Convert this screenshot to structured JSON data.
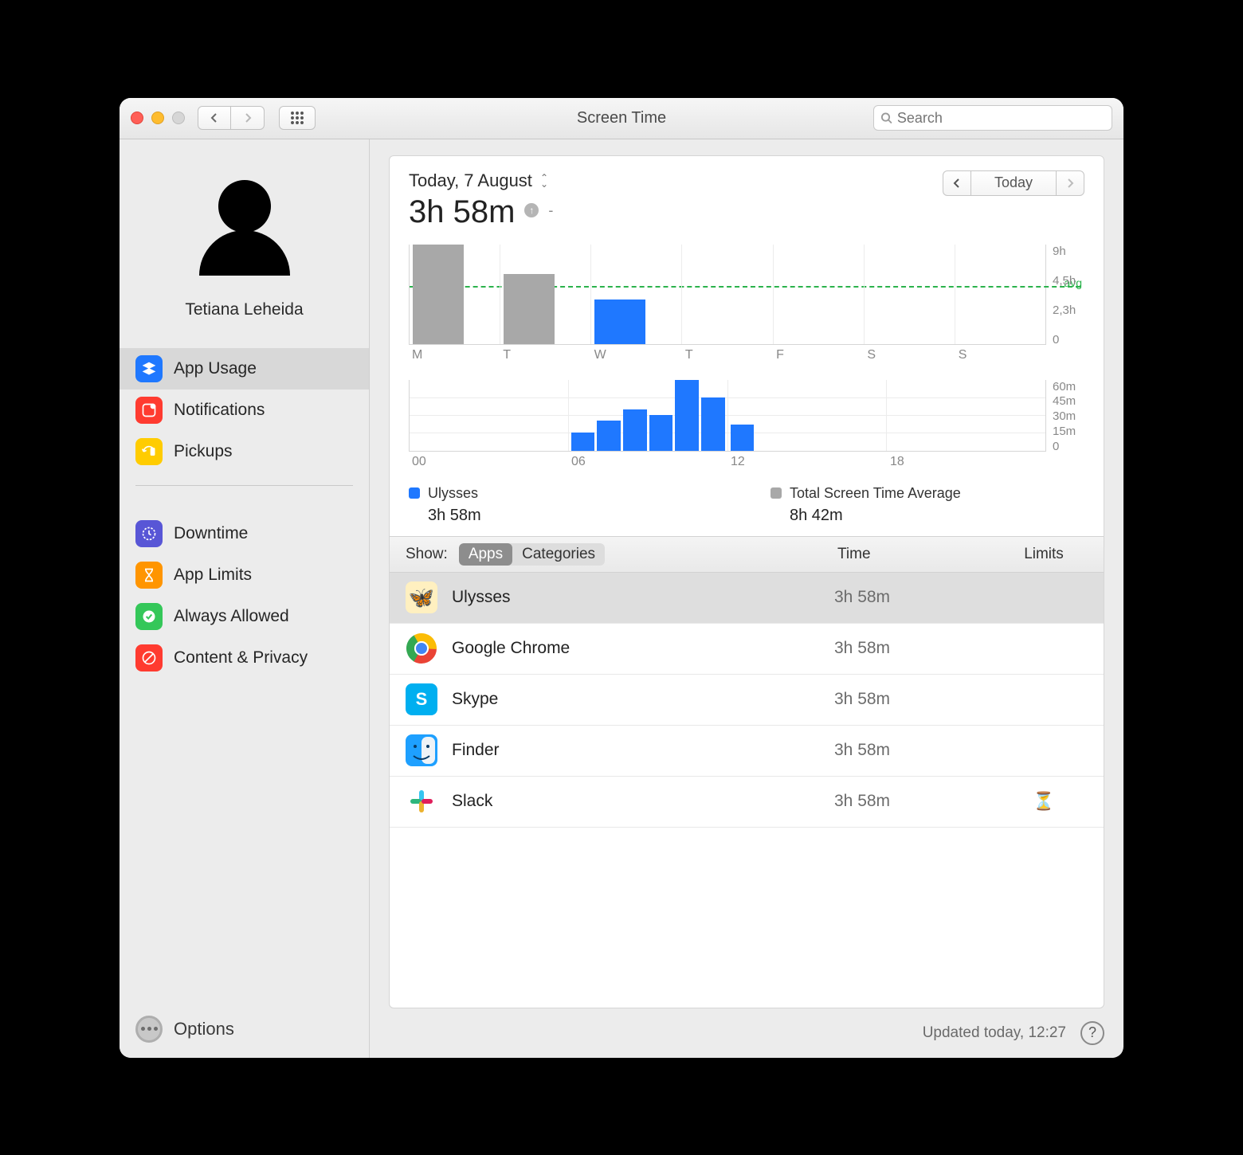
{
  "window": {
    "title": "Screen Time",
    "search_placeholder": "Search"
  },
  "profile": {
    "name": "Tetiana Leheida"
  },
  "sidebar": {
    "items": [
      {
        "label": "App Usage",
        "color": "#1f78ff",
        "selected": true
      },
      {
        "label": "Notifications",
        "color": "#ff3b30"
      },
      {
        "label": "Pickups",
        "color": "#ffcc00"
      }
    ],
    "items2": [
      {
        "label": "Downtime",
        "color": "#5856d6"
      },
      {
        "label": "App Limits",
        "color": "#ff9500"
      },
      {
        "label": "Always Allowed",
        "color": "#34c759"
      },
      {
        "label": "Content & Privacy",
        "color": "#ff3b30"
      }
    ],
    "options_label": "Options"
  },
  "header": {
    "date": "Today, 7 August",
    "total": "3h 58m",
    "delta": "-",
    "period_label": "Today"
  },
  "chart_data": [
    {
      "type": "bar",
      "categories": [
        "M",
        "T",
        "W",
        "T",
        "F",
        "S",
        "S"
      ],
      "series": [
        {
          "name": "Total Screen Time Average",
          "color": "#a8a8a8",
          "values": [
            9.0,
            6.3,
            0,
            0,
            0,
            0,
            0
          ]
        },
        {
          "name": "Ulysses",
          "color": "#1f78ff",
          "values": [
            0,
            0,
            3.97,
            0,
            0,
            0,
            0
          ]
        }
      ],
      "ylabel": "",
      "ylim": [
        0,
        9
      ],
      "yticks": [
        "9h",
        "4,5h",
        "2,3h",
        "0"
      ],
      "avg_line": 5.2,
      "avg_label": "avg"
    },
    {
      "type": "bar",
      "x": [
        "00",
        "06",
        "12",
        "18"
      ],
      "hourly_minutes": {
        "6": 15,
        "7": 25,
        "8": 35,
        "9": 30,
        "10": 60,
        "11": 45,
        "12": 22
      },
      "ylim": [
        0,
        60
      ],
      "yticks": [
        "60m",
        "45m",
        "30m",
        "15m",
        "0"
      ]
    }
  ],
  "legend": {
    "a_name": "Ulysses",
    "a_value": "3h 58m",
    "b_name": "Total Screen Time Average",
    "b_value": "8h 42m"
  },
  "table": {
    "show_label": "Show:",
    "seg_apps": "Apps",
    "seg_categories": "Categories",
    "col_time": "Time",
    "col_limits": "Limits",
    "rows": [
      {
        "name": "Ulysses",
        "time": "3h 58m",
        "selected": true,
        "icon_bg": "#fff0c0",
        "glyph": "🦋"
      },
      {
        "name": "Google Chrome",
        "time": "3h 58m",
        "icon_bg": "#fff"
      },
      {
        "name": "Skype",
        "time": "3h 58m",
        "icon_bg": "#00aff0"
      },
      {
        "name": "Finder",
        "time": "3h 58m",
        "icon_bg": "#1ea0ff"
      },
      {
        "name": "Slack",
        "time": "3h 58m",
        "has_limit": true,
        "icon_bg": "#fff"
      }
    ]
  },
  "footer": {
    "updated": "Updated today, 12:27"
  }
}
